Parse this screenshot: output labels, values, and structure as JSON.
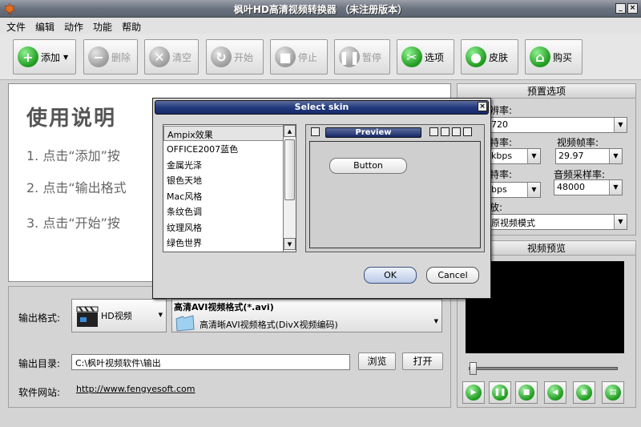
{
  "window": {
    "title": "枫叶HD高清视频转换器 （未注册版本）"
  },
  "menu": [
    "文件",
    "编辑",
    "动作",
    "功能",
    "帮助"
  ],
  "toolbar": {
    "add": "添加",
    "delete": "删除",
    "clear": "清空",
    "start": "开始",
    "stop": "停止",
    "pause": "暂停",
    "options": "选项",
    "skin": "皮肤",
    "buy": "购买"
  },
  "instructions": {
    "title": "使用说明",
    "step1": "1. 点击“添加”按",
    "step2": "2. 点击“输出格式",
    "step3": "3. 点击“开始”按"
  },
  "output": {
    "format_label": "输出格式:",
    "format_category": "HD视频",
    "format_title": "高清AVI视频格式(*.avi)",
    "format_desc": "高清晰AVI视频格式(DivX视频编码)",
    "dir_label": "输出目录:",
    "dir_value": "C:\\枫叶视频软件\\输出",
    "browse": "浏览",
    "open": "打开",
    "site_label": "软件网站:",
    "site_url": "http://www.fengyesoft.com"
  },
  "presets": {
    "header": "预置选项",
    "resolution_label": "辨率:",
    "resolution_value": "720",
    "vbitrate_label": "特率:",
    "vbitrate_value": "kbps",
    "framerate_label": "视频帧率:",
    "framerate_value": "29.97",
    "abitrate_label": "特率:",
    "abitrate_value": "bps",
    "samplerate_label": "音频采样率:",
    "samplerate_value": "48000",
    "zoom_label": "放:",
    "zoom_value": "原视频模式"
  },
  "preview": {
    "header": "视频预览"
  },
  "dialog": {
    "title": "Select skin",
    "skins": [
      "Ampix效果",
      "OFFICE2007蓝色",
      "金属光泽",
      "银色天地",
      "Mac风格",
      "条纹色调",
      "纹理风格",
      "绿色世界"
    ],
    "selected_index": 0,
    "preview_title": "Preview",
    "preview_button": "Button",
    "ok": "OK",
    "cancel": "Cancel"
  }
}
